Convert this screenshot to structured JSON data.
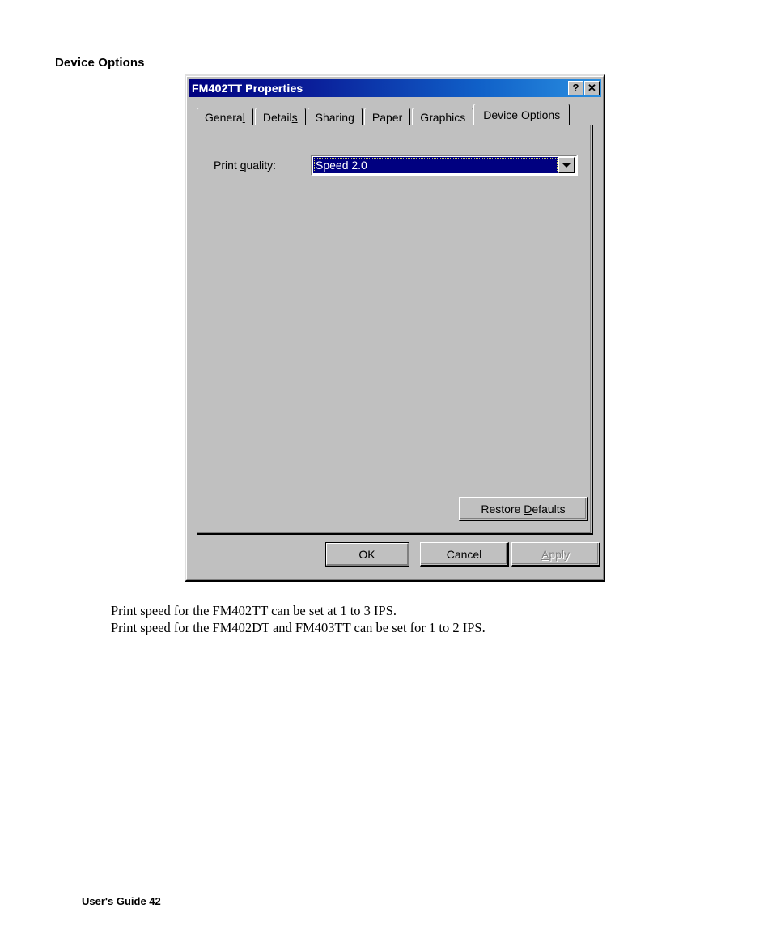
{
  "page": {
    "heading": "Device Options",
    "body_lines": [
      "Print speed for the FM402TT can be set at 1 to 3 IPS.",
      "Print speed for the FM402DT and FM403TT can be set for 1 to 2 IPS."
    ],
    "footer": "User's Guide 42"
  },
  "dialog": {
    "title": "FM402TT Properties",
    "titlebar_buttons": [
      {
        "name": "help-button",
        "glyph": "?"
      },
      {
        "name": "close-button",
        "glyph": "✕"
      }
    ],
    "tabs": [
      {
        "label": "General",
        "accel": "l",
        "active": false
      },
      {
        "label": "Details",
        "accel": "s",
        "active": false
      },
      {
        "label": "Sharing",
        "accel": "g",
        "active": false
      },
      {
        "label": "Paper",
        "accel": "",
        "active": false
      },
      {
        "label": "Graphics",
        "accel": "",
        "active": false
      },
      {
        "label": "Device Options",
        "accel": "",
        "active": true
      }
    ],
    "panel": {
      "print_quality": {
        "label_before": "Print ",
        "label_accel": "q",
        "label_after": "uality:",
        "value": "Speed 2.0",
        "dropdown_icon": "chevron-down-icon"
      },
      "restore_defaults": {
        "before": "Restore ",
        "accel": "D",
        "after": "efaults"
      }
    },
    "footer_buttons": {
      "ok": "OK",
      "cancel": "Cancel",
      "apply_before": "",
      "apply_accel": "A",
      "apply_after": "pply",
      "apply_disabled": true
    }
  },
  "colors": {
    "dialog_face": "#c0c0c0",
    "title_gradient_start": "#00007f",
    "title_gradient_end": "#2a8fe0",
    "selection_navy": "#000080",
    "focus_dotted": "#cccc66",
    "disabled_text": "#808080"
  }
}
